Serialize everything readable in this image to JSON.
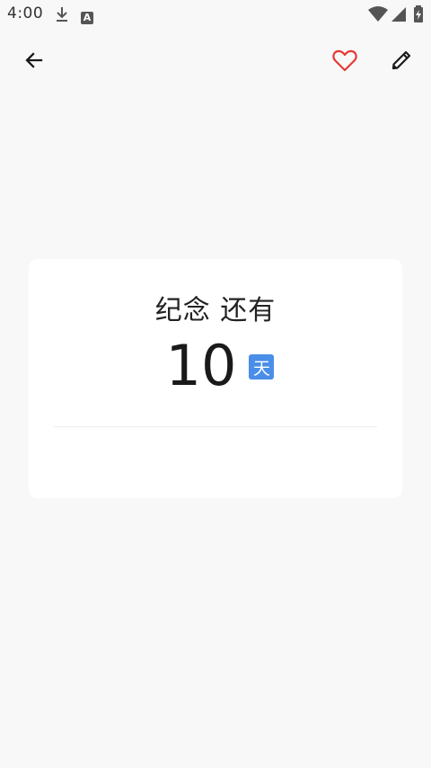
{
  "status_bar": {
    "time": "4:00",
    "icons": [
      "download-icon",
      "a-letter-icon",
      "wifi-icon",
      "signal-icon",
      "battery-icon"
    ],
    "badge_letter": "A"
  },
  "toolbar": {
    "back_icon": "arrow-left-icon",
    "favorite_icon": "heart-outline-icon",
    "edit_icon": "pencil-icon",
    "favorite_color": "#e53935"
  },
  "card": {
    "title": "纪念 还有",
    "count": "10",
    "unit": "天",
    "unit_color": "#4a8ee8"
  }
}
